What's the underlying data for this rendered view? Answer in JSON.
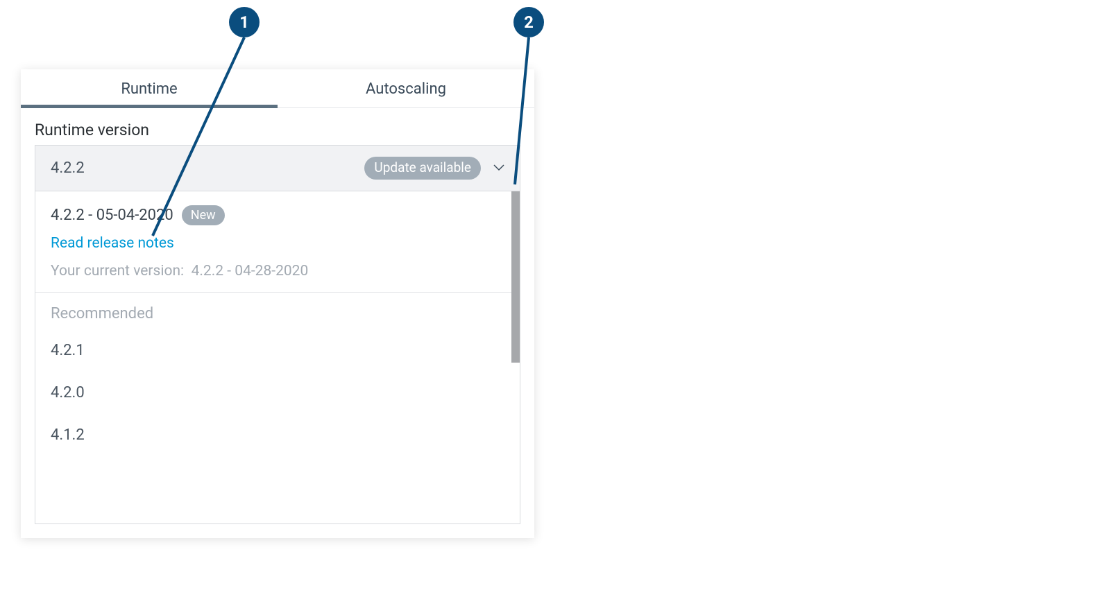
{
  "callouts": {
    "one": "1",
    "two": "2"
  },
  "tabs": {
    "runtime": "Runtime",
    "autoscaling": "Autoscaling"
  },
  "runtime": {
    "section_label": "Runtime version",
    "selected_value": "4.2.2",
    "update_badge": "Update available",
    "dropdown": {
      "latest_label": "4.2.2 - 05-04-2020",
      "new_badge": "New",
      "release_notes_link": "Read release notes",
      "current_prefix": "Your current version:",
      "current_value": "4.2.2 - 04-28-2020",
      "recommended_label": "Recommended",
      "items": [
        "4.2.1",
        "4.2.0",
        "4.1.2"
      ]
    }
  }
}
